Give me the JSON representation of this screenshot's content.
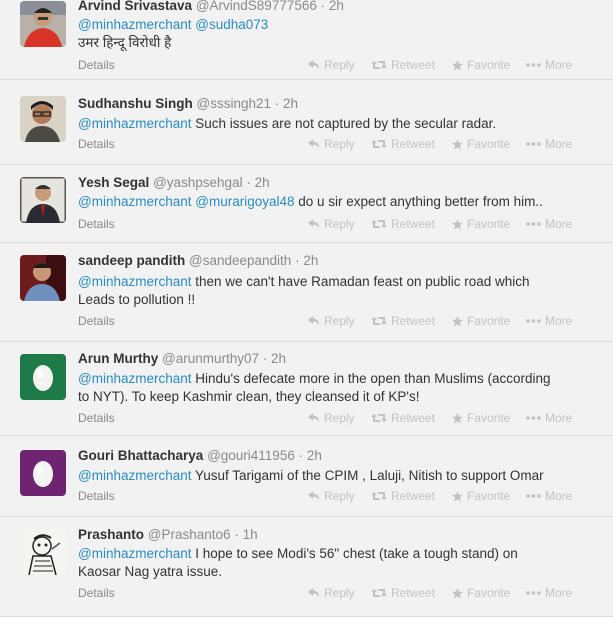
{
  "actions": {
    "details": "Details",
    "reply": "Reply",
    "retweet": "Retweet",
    "favorite": "Favorite",
    "more": "More"
  },
  "tweets": [
    {
      "name": "Arvind Srivastava",
      "handle": "@ArvindS89777566",
      "time": "2h",
      "avatar": "photo-red-man",
      "lines": [
        [
          {
            "t": "@minhazmerchant",
            "m": true
          },
          {
            "t": " ",
            "m": false
          },
          {
            "t": "@sudha073",
            "m": true
          }
        ],
        [
          {
            "t": "उमर हिन्दू विरोधी है",
            "m": false
          }
        ]
      ]
    },
    {
      "name": "Sudhanshu Singh",
      "handle": "@sssingh21",
      "time": "2h",
      "avatar": "photo-man-glasses",
      "lines": [
        [
          {
            "t": "@minhazmerchant",
            "m": true
          },
          {
            "t": " Such issues are not captured by the secular radar.",
            "m": false
          }
        ]
      ]
    },
    {
      "name": "Yesh Segal",
      "handle": "@yashpsehgal",
      "time": "2h",
      "avatar": "photo-man-suit",
      "lines": [
        [
          {
            "t": "@minhazmerchant",
            "m": true
          },
          {
            "t": " ",
            "m": false
          },
          {
            "t": "@murarigoyal48",
            "m": true
          },
          {
            "t": " do u sir expect anything better from him..",
            "m": false
          }
        ]
      ]
    },
    {
      "name": "sandeep pandith",
      "handle": "@sandeepandith",
      "time": "2h",
      "avatar": "photo-man-blue",
      "lines": [
        [
          {
            "t": "@minhazmerchant",
            "m": true
          },
          {
            "t": " then we can't have Ramadan feast on public road which",
            "m": false
          }
        ],
        [
          {
            "t": "Leads to pollution !!",
            "m": false
          }
        ]
      ]
    },
    {
      "name": "Arun Murthy",
      "handle": "@arunmurthy07",
      "time": "2h",
      "avatar": "egg-green",
      "lines": [
        [
          {
            "t": "@minhazmerchant",
            "m": true
          },
          {
            "t": " Hindu's defecate more in the open than Muslims (according",
            "m": false
          }
        ],
        [
          {
            "t": "to NYT). To keep Kashmir clean, they cleansed it of KP's!",
            "m": false
          }
        ]
      ]
    },
    {
      "name": "Gouri Bhattacharya",
      "handle": "@gouri411956",
      "time": "2h",
      "avatar": "egg-purple",
      "lines": [
        [
          {
            "t": "@minhazmerchant",
            "m": true
          },
          {
            "t": " Yusuf Tarigami of the CPIM , Laluji, Nitish to support Omar",
            "m": false
          }
        ]
      ]
    },
    {
      "name": "Prashanto",
      "handle": "@Prashanto6",
      "time": "1h",
      "avatar": "cartoon-sketch",
      "lines": [
        [
          {
            "t": "@minhazmerchant",
            "m": true
          },
          {
            "t": " I hope to see Modi's 56\" chest (take a tough stand) on",
            "m": false
          }
        ],
        [
          {
            "t": "Kaosar Nag yatra issue.",
            "m": false
          }
        ]
      ]
    }
  ]
}
